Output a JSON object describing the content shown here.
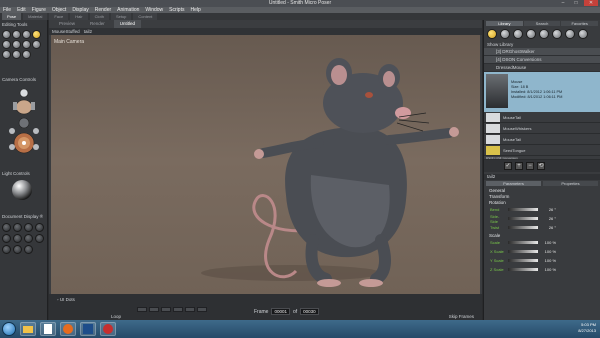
{
  "window": {
    "title": "Untitled - Smith Micro Poser",
    "min": "–",
    "max": "□",
    "close": "✕"
  },
  "menu": [
    "File",
    "Edit",
    "Figure",
    "Object",
    "Display",
    "Render",
    "Animation",
    "Window",
    "Scripts",
    "Help"
  ],
  "rooms": [
    "Pose",
    "Material",
    "Face",
    "Hair",
    "Cloth",
    "Setup",
    "Content"
  ],
  "left": {
    "editing_tools": "Editing Tools",
    "camera_controls": "Camera Controls",
    "light_controls": "Light Controls",
    "document_display": "Document Display ®"
  },
  "viewport": {
    "tabs": [
      "Preview",
      "Render",
      "Untitled"
    ],
    "active_tab": "Untitled",
    "figure_select": "MouseStuffed",
    "part_select": "tail2",
    "camera_label": "Main Camera"
  },
  "timeline": {
    "toggle": "◦ UI Dots",
    "frame_label": "Frame",
    "frame_current": "00001",
    "frame_of": "of",
    "frame_total": "00030",
    "loop": "Loop",
    "skip": "Skip Frames"
  },
  "library": {
    "tabs": [
      "Library",
      "Search",
      "Favorites"
    ],
    "show_label": "Show Library",
    "rows": [
      {
        "label": "[3] DRGhostWalker",
        "folder": true
      },
      {
        "label": "[4] DSON Conversions",
        "folder": true
      },
      {
        "label": "DressedMouse",
        "folder": false
      }
    ],
    "card": {
      "name": "Mouse",
      "size": "Size: 18 B",
      "installed": "Installed: 8/1/2012 1:06:11 PM",
      "modified": "Modified: 8/1/2012 1:06:11 PM"
    },
    "items": [
      "MouseTail",
      "MouseWhiskers",
      "MouseTail",
      "SeedTongue",
      "DSON CNF Conversion"
    ],
    "toolbar": [
      "✓",
      "+",
      "−",
      "⟲"
    ]
  },
  "parameters": {
    "title": "tail2",
    "tabs": [
      "Parameters",
      "Properties"
    ],
    "general": "General",
    "transform": "Transform",
    "rotation": "Rotation",
    "rotation_dials": [
      {
        "name": "Bend",
        "value": "26 °"
      },
      {
        "name": "Side-Side",
        "value": "26 °"
      },
      {
        "name": "Twist",
        "value": "26 °"
      }
    ],
    "scale": "Scale",
    "scale_dials": [
      {
        "name": "Scale",
        "value": "100 %"
      },
      {
        "name": "X Scale",
        "value": "100 %"
      },
      {
        "name": "Y Scale",
        "value": "100 %"
      },
      {
        "name": "Z Scale",
        "value": "100 %"
      }
    ]
  },
  "taskbar": {
    "time": "5:03 PM",
    "date": "8/27/2013"
  }
}
